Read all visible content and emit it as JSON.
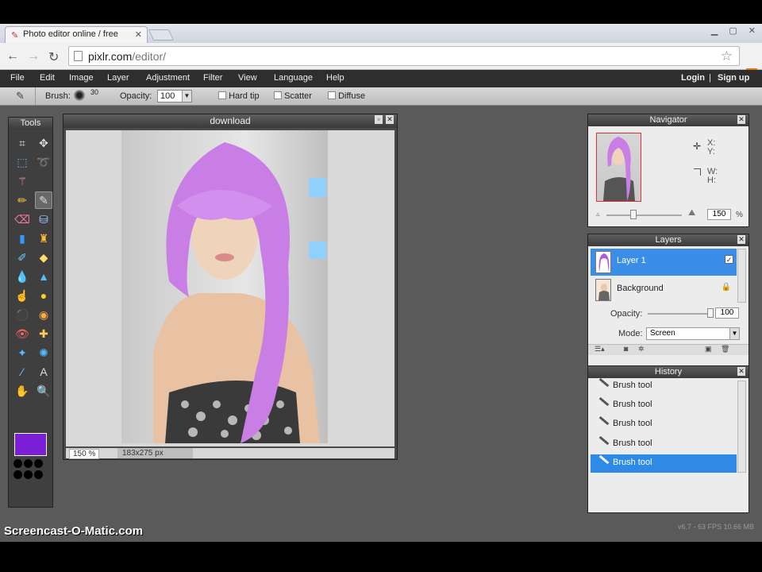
{
  "browser": {
    "tab_title": "Photo editor online / free",
    "url_host": "pixlr.com",
    "url_path": "/editor/"
  },
  "menubar": {
    "items": [
      "File",
      "Edit",
      "Image",
      "Layer",
      "Adjustment",
      "Filter",
      "View",
      "Language",
      "Help"
    ],
    "login": "Login",
    "separator": "|",
    "signup": "Sign up"
  },
  "options": {
    "brush_label": "Brush:",
    "brush_size": "30",
    "opacity_label": "Opacity:",
    "opacity_value": "100",
    "hard_tip": "Hard tip",
    "scatter": "Scatter",
    "diffuse": "Diffuse"
  },
  "tools": {
    "title": "Tools",
    "primary_color": "#7b1fd6"
  },
  "document": {
    "title": "download",
    "zoom": "150 %",
    "size": "183x275 px"
  },
  "navigator": {
    "title": "Navigator",
    "x_label": "X:",
    "y_label": "Y:",
    "w_label": "W:",
    "h_label": "H:",
    "zoom_value": "150",
    "zoom_unit": "%"
  },
  "layers": {
    "title": "Layers",
    "items": [
      {
        "name": "Layer 1",
        "selected": true
      },
      {
        "name": "Background",
        "locked": true
      }
    ],
    "opacity_label": "Opacity:",
    "opacity_value": "100",
    "mode_label": "Mode:",
    "mode_value": "Screen"
  },
  "history": {
    "title": "History",
    "items": [
      "Brush tool",
      "Brush tool",
      "Brush tool",
      "Brush tool",
      "Brush tool"
    ],
    "selected_index": 4
  },
  "overlay": {
    "watermark": "Screencast-O-Matic.com",
    "stats": "v6.7 - 63 FPS 10.66 MB"
  }
}
